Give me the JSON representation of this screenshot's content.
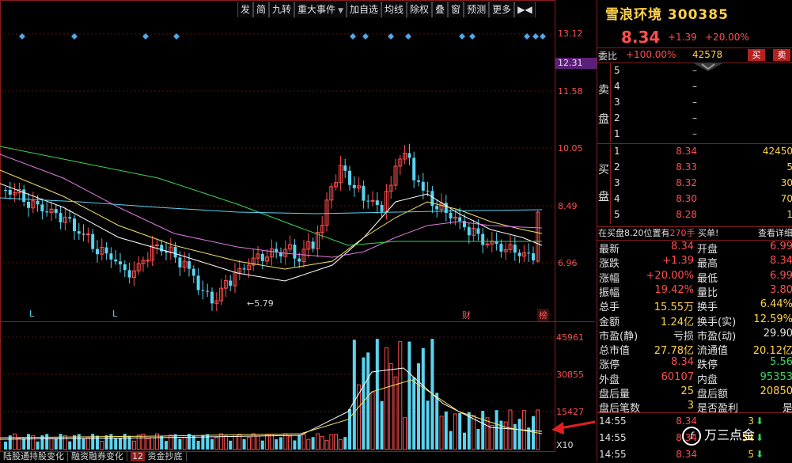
{
  "toolbar": [
    "发",
    "简",
    "九转",
    "重大事件",
    "加自选",
    "均线",
    "除权",
    "叠",
    "窗",
    "预测",
    "更多"
  ],
  "toolbar_nav": "▶",
  "toolbar_nav2": "◀",
  "price_axis": [
    "13.12",
    "12.31",
    "11.58",
    "10.05",
    "8.49",
    "6.96"
  ],
  "volume_axis": [
    "45961",
    "30855",
    "15427"
  ],
  "volume_unit": "X10",
  "low_label": "5.79",
  "markers": {
    "L1": "L",
    "L2": "L",
    "cai": "财",
    "bang": "榜"
  },
  "bottom_tabs": [
    "陆股通持股变化",
    "融资融券变化",
    "资金抄底"
  ],
  "bottom_tab_num": "12",
  "stock": {
    "name": "雪浪环境",
    "code": "300385",
    "price": "8.34",
    "change": "+1.39",
    "pct": "+20.00%"
  },
  "ratio": {
    "label": "委比",
    "value": "+100.00%",
    "diff": "42578",
    "sell_btn": "买",
    "buy_btn": "卖"
  },
  "orderbook": {
    "sell_label": [
      "卖",
      "盘"
    ],
    "buy_label": [
      "买",
      "盘"
    ],
    "asks": [
      {
        "lv": "5",
        "price": "–",
        "vol": ""
      },
      {
        "lv": "4",
        "price": "–",
        "vol": ""
      },
      {
        "lv": "3",
        "price": "–",
        "vol": ""
      },
      {
        "lv": "2",
        "price": "–",
        "vol": ""
      },
      {
        "lv": "1",
        "price": "–",
        "vol": ""
      }
    ],
    "bids": [
      {
        "lv": "1",
        "price": "8.34",
        "vol": "42450"
      },
      {
        "lv": "2",
        "price": "8.33",
        "vol": "5"
      },
      {
        "lv": "3",
        "price": "8.32",
        "vol": "30"
      },
      {
        "lv": "4",
        "price": "8.30",
        "vol": "70"
      },
      {
        "lv": "5",
        "price": "8.28",
        "vol": "1"
      }
    ]
  },
  "info_bar": {
    "text": "在买盘8.20位置有",
    "qty": "270手",
    "tail": "买单!",
    "link": "查看详细"
  },
  "stats": [
    {
      "k1": "最新",
      "v1": "8.34",
      "c1": "red",
      "k2": "开盘",
      "v2": "6.99",
      "c2": "red"
    },
    {
      "k1": "涨跌",
      "v1": "+1.39",
      "c1": "red",
      "k2": "最高",
      "v2": "8.34",
      "c2": "red"
    },
    {
      "k1": "涨幅",
      "v1": "+20.00%",
      "c1": "red",
      "k2": "最低",
      "v2": "6.99",
      "c2": "red"
    },
    {
      "k1": "振幅",
      "v1": "19.42%",
      "c1": "red",
      "k2": "量比",
      "v2": "3.80",
      "c2": "red"
    },
    {
      "k1": "总手",
      "v1": "15.55万",
      "c1": "yel",
      "k2": "换手",
      "v2": "6.44%",
      "c2": "yel"
    },
    {
      "k1": "金额",
      "v1": "1.24亿",
      "c1": "yel",
      "k2": "换手(实)",
      "v2": "12.59%",
      "c2": "yel"
    },
    {
      "k1": "市盈(静)",
      "v1": "亏损",
      "c1": "wht",
      "k2": "市盈(动)",
      "v2": "29.90",
      "c2": "wht"
    },
    {
      "k1": "总市值",
      "v1": "27.78亿",
      "c1": "yel",
      "k2": "流通值",
      "v2": "20.12亿",
      "c2": "yel"
    },
    {
      "k1": "涨停",
      "v1": "8.34",
      "c1": "red",
      "k2": "跌停",
      "v2": "5.56",
      "c2": "grn"
    },
    {
      "k1": "外盘",
      "v1": "60107",
      "c1": "red",
      "k2": "内盘",
      "v2": "95353",
      "c2": "grn"
    },
    {
      "k1": "盘后量",
      "v1": "25",
      "c1": "yel",
      "k2": "盘后额",
      "v2": "20850",
      "c2": "yel"
    },
    {
      "k1": "盘后笔数",
      "v1": "3",
      "c1": "yel",
      "k2": "是否盈利",
      "v2": "是",
      "c2": "wht"
    }
  ],
  "ticks": [
    {
      "t": "14:55",
      "p": "8.34",
      "q": "3"
    },
    {
      "t": "14:55",
      "p": "8.34",
      "q": "54"
    },
    {
      "t": "14:55",
      "p": "8.34",
      "q": "5"
    }
  ],
  "watermark": "万三点金",
  "watermark_logo": "f",
  "colors": {
    "up": "#ff4f4f",
    "down": "#5ad4f0",
    "panel_border": "#8b1c1c",
    "accent": "#ffd24a"
  }
}
